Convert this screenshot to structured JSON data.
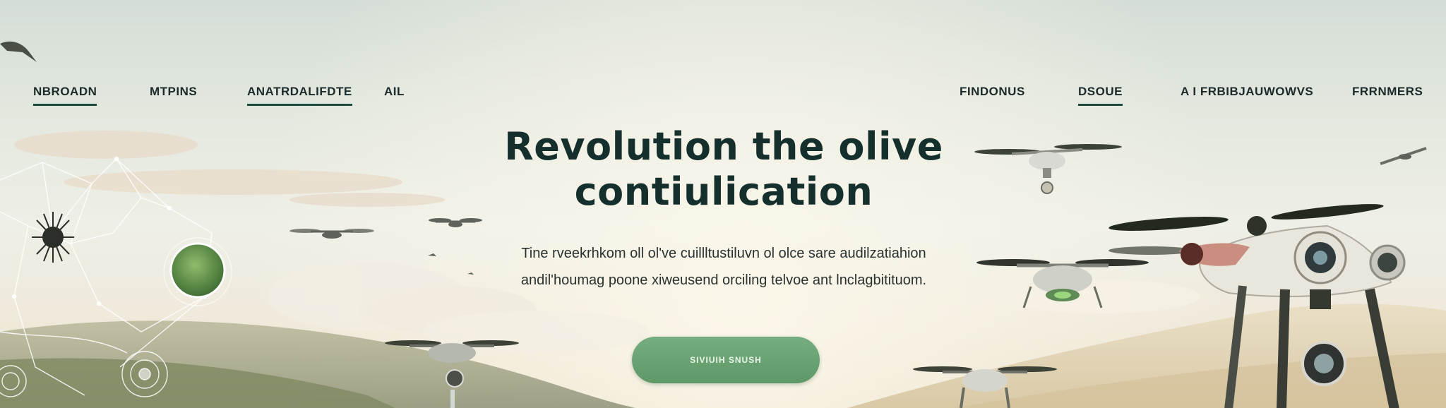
{
  "nav": {
    "left": [
      {
        "label": "NBROADN",
        "underlined": true
      },
      {
        "label": "MTPINS",
        "underlined": false
      },
      {
        "label": "ANATRDALIFDTE",
        "underlined": true
      },
      {
        "label": "AIL",
        "underlined": false
      }
    ],
    "right": [
      {
        "label": "FINDONUS",
        "underlined": false
      },
      {
        "label": "DSOUE",
        "underlined": true
      },
      {
        "label": "A I FRBIBJAUWOWVS",
        "underlined": false
      },
      {
        "label": "FRRNMERS",
        "underlined": false
      }
    ]
  },
  "hero": {
    "title_line1": "Revolution the olive",
    "title_line2": "contiulication",
    "subtitle_line1": "Tine rveekrhkom oll ol've cuillltustiluvn ol olce sare audilzatiahion",
    "subtitle_line2": "andil'houmag poone xiweusend orciling telvoe ant lnclagbitituom.",
    "cta_label": "SIVIUIH SNUSH"
  },
  "colors": {
    "accent_green": "#6aa374",
    "title_dark": "#15302c",
    "nav_text": "#1d2a2a"
  }
}
